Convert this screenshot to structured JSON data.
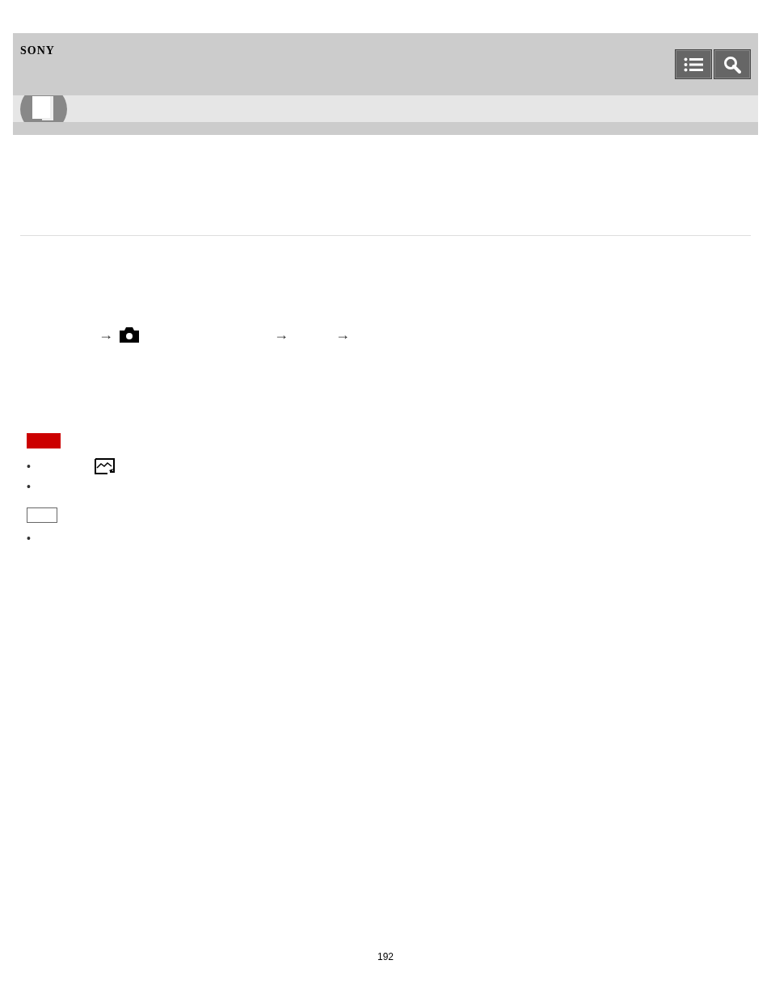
{
  "header": {
    "logo": "SONY"
  },
  "steps": [
    "→",
    "→",
    "→"
  ],
  "notes": [
    {
      "kind": "caution",
      "bullets": [
        "•",
        "•"
      ]
    },
    {
      "kind": "note",
      "bullets": [
        "•"
      ]
    }
  ],
  "page_number": "192"
}
